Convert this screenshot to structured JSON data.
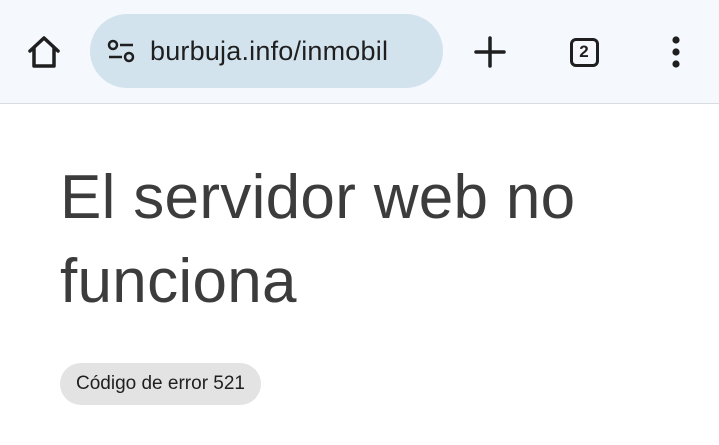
{
  "browser": {
    "url": "burbuja.info/inmobil",
    "tab_count": "2",
    "icons": {
      "home": "home-icon",
      "site_settings": "tune-icon",
      "new_tab": "plus-icon",
      "tabs": "tab-switcher-icon",
      "menu": "more-vert-icon"
    }
  },
  "page": {
    "headline": "El servidor web no funciona",
    "error_code": "Código de error 521"
  },
  "colors": {
    "toolbar_bg": "#f5f8fc",
    "omnibox_bg": "#d3e3ee",
    "chip_bg": "#e3e3e3",
    "headline": "#3c3c3c"
  }
}
